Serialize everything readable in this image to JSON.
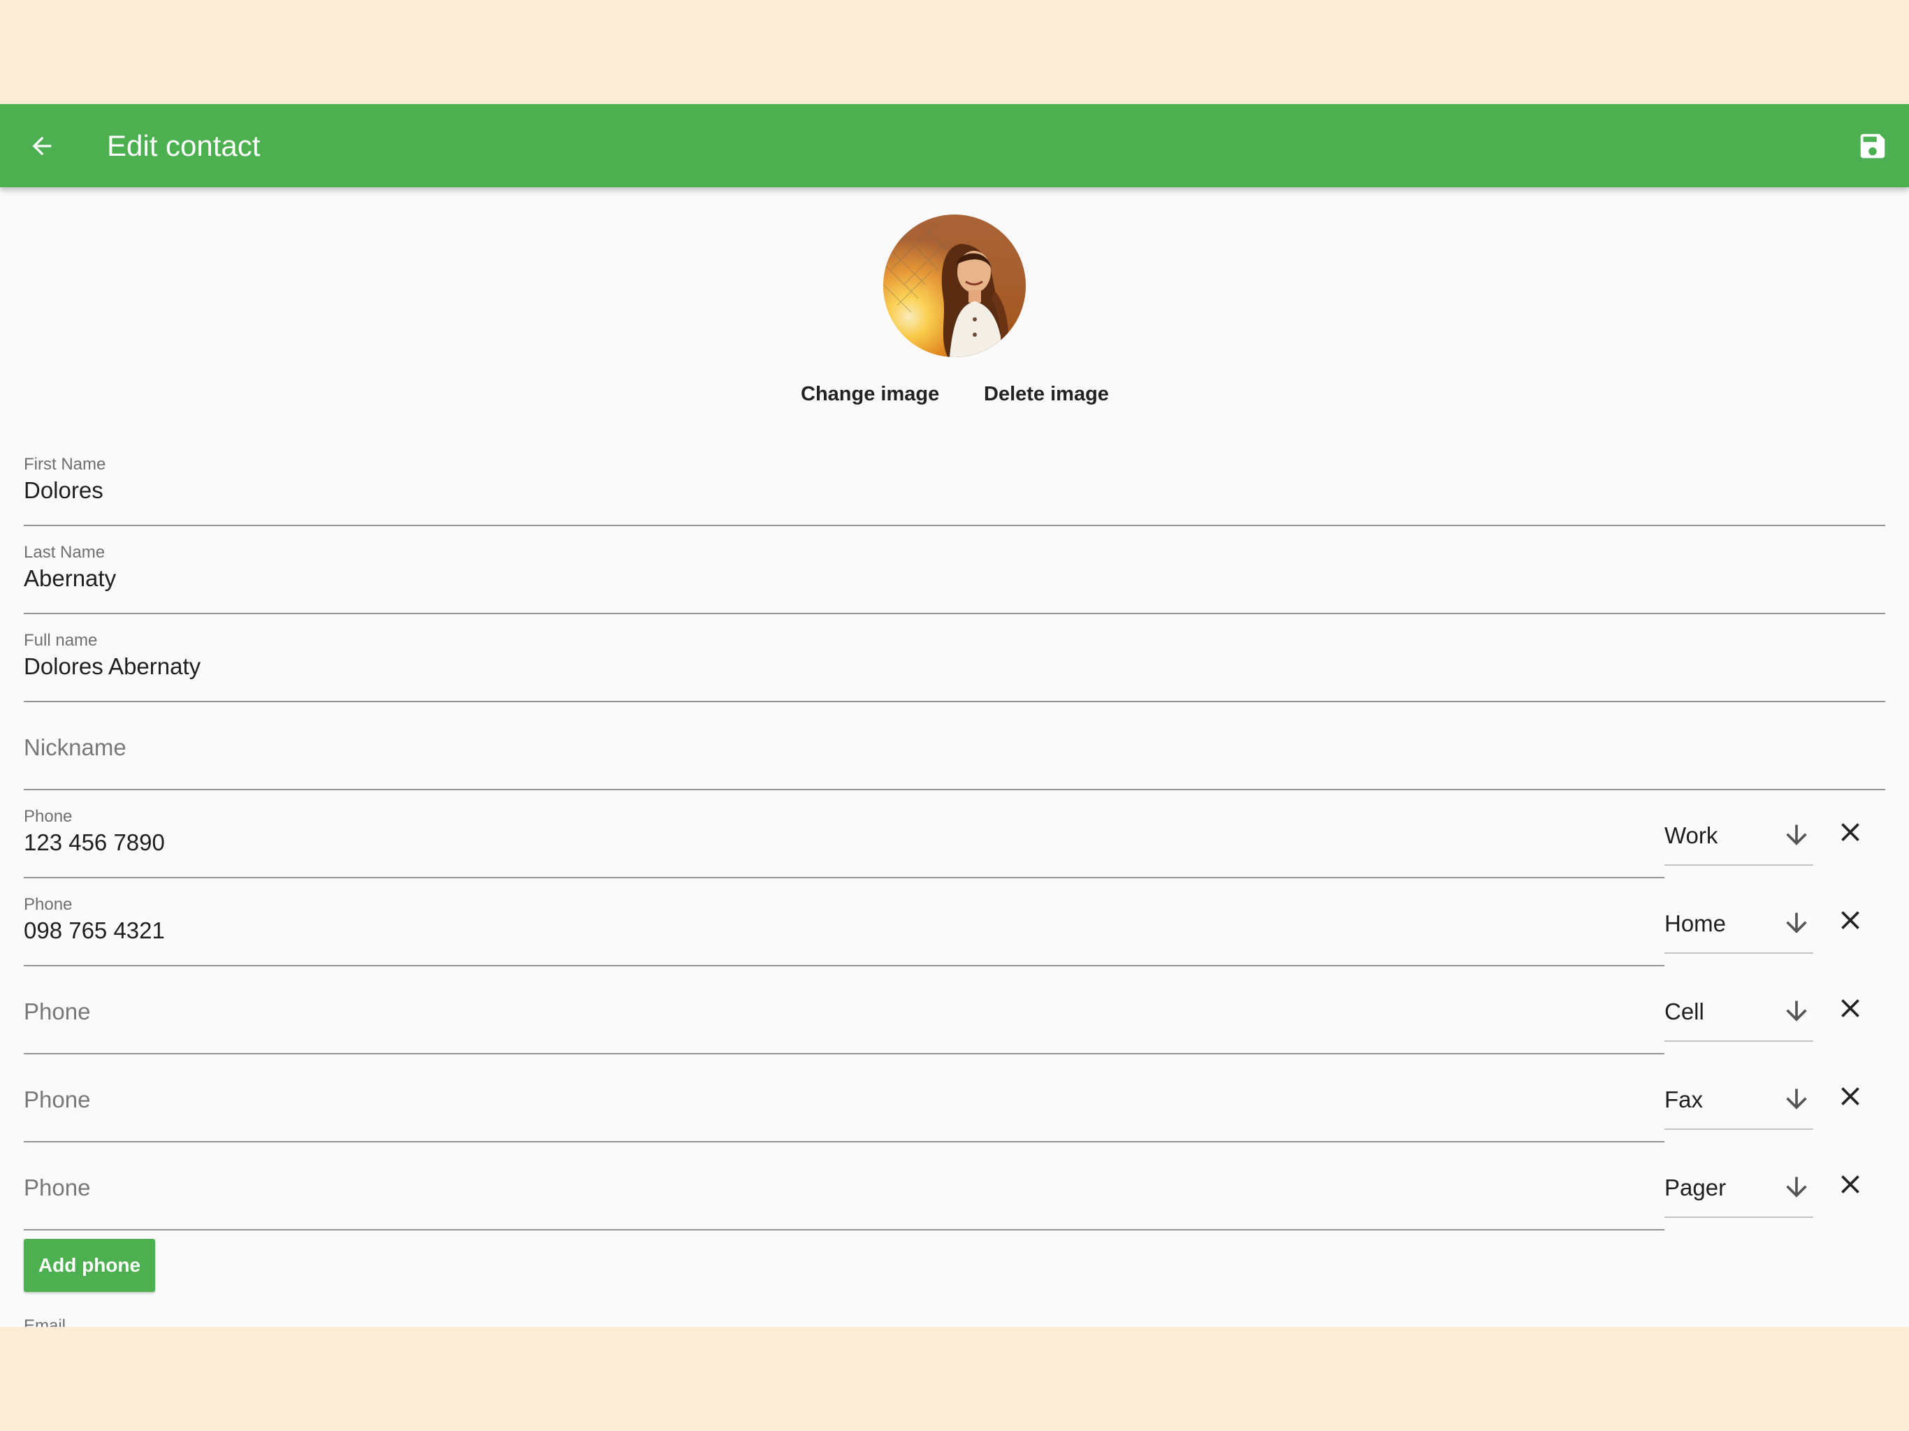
{
  "appbar": {
    "title": "Edit contact",
    "back_icon": "arrow-left-icon",
    "save_icon": "floppy-disk-icon",
    "color": "#4caf50"
  },
  "avatar": {
    "icon": "contact-photo"
  },
  "image_actions": {
    "change": "Change image",
    "delete": "Delete image"
  },
  "fields": {
    "first_name": {
      "label": "First Name",
      "value": "Dolores"
    },
    "last_name": {
      "label": "Last Name",
      "value": "Abernaty"
    },
    "full_name": {
      "label": "Full name",
      "value": "Dolores Abernaty"
    },
    "nickname": {
      "placeholder": "Nickname"
    }
  },
  "phones": [
    {
      "label": "Phone",
      "value": "123 456 7890",
      "type": "Work"
    },
    {
      "label": "Phone",
      "value": "098 765 4321",
      "type": "Home"
    },
    {
      "placeholder": "Phone",
      "type": "Cell"
    },
    {
      "placeholder": "Phone",
      "type": "Fax"
    },
    {
      "placeholder": "Phone",
      "type": "Pager"
    }
  ],
  "add_phone": "Add phone",
  "next_section_label": "Email"
}
